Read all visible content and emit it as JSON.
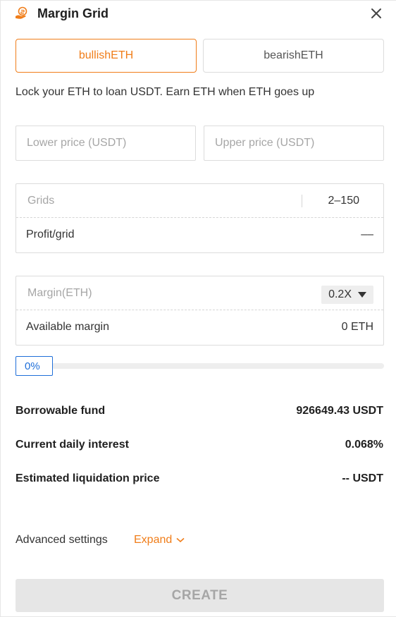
{
  "header": {
    "title": "Margin Grid",
    "close_icon": "close-icon",
    "logo_icon": "hand-coin-icon"
  },
  "tabs": [
    {
      "label": "bullishETH",
      "active": true
    },
    {
      "label": "bearishETH",
      "active": false
    }
  ],
  "description": "Lock your ETH to loan USDT. Earn ETH when ETH goes up",
  "price": {
    "lower_placeholder": "Lower price (USDT)",
    "upper_placeholder": "Upper price (USDT)"
  },
  "grid": {
    "placeholder": "Grids",
    "range": "2–150",
    "profit_label": "Profit/grid",
    "profit_value": "––"
  },
  "margin": {
    "placeholder": "Margin(ETH)",
    "leverage": "0.2X",
    "available_label": "Available margin",
    "available_value": "0 ETH"
  },
  "slider": {
    "label": "0%",
    "percent": 0
  },
  "stats": {
    "borrowable_label": "Borrowable fund",
    "borrowable_value": "926649.43 USDT",
    "interest_label": "Current daily interest",
    "interest_value": "0.068%",
    "liquidation_label": "Estimated liquidation price",
    "liquidation_value": "-- USDT"
  },
  "advanced": {
    "label": "Advanced settings",
    "expand_label": "Expand"
  },
  "create_label": "CREATE",
  "colors": {
    "accent": "#f07d19",
    "slider": "#1f6fd9",
    "disabled_bg": "#e6e6e6"
  }
}
